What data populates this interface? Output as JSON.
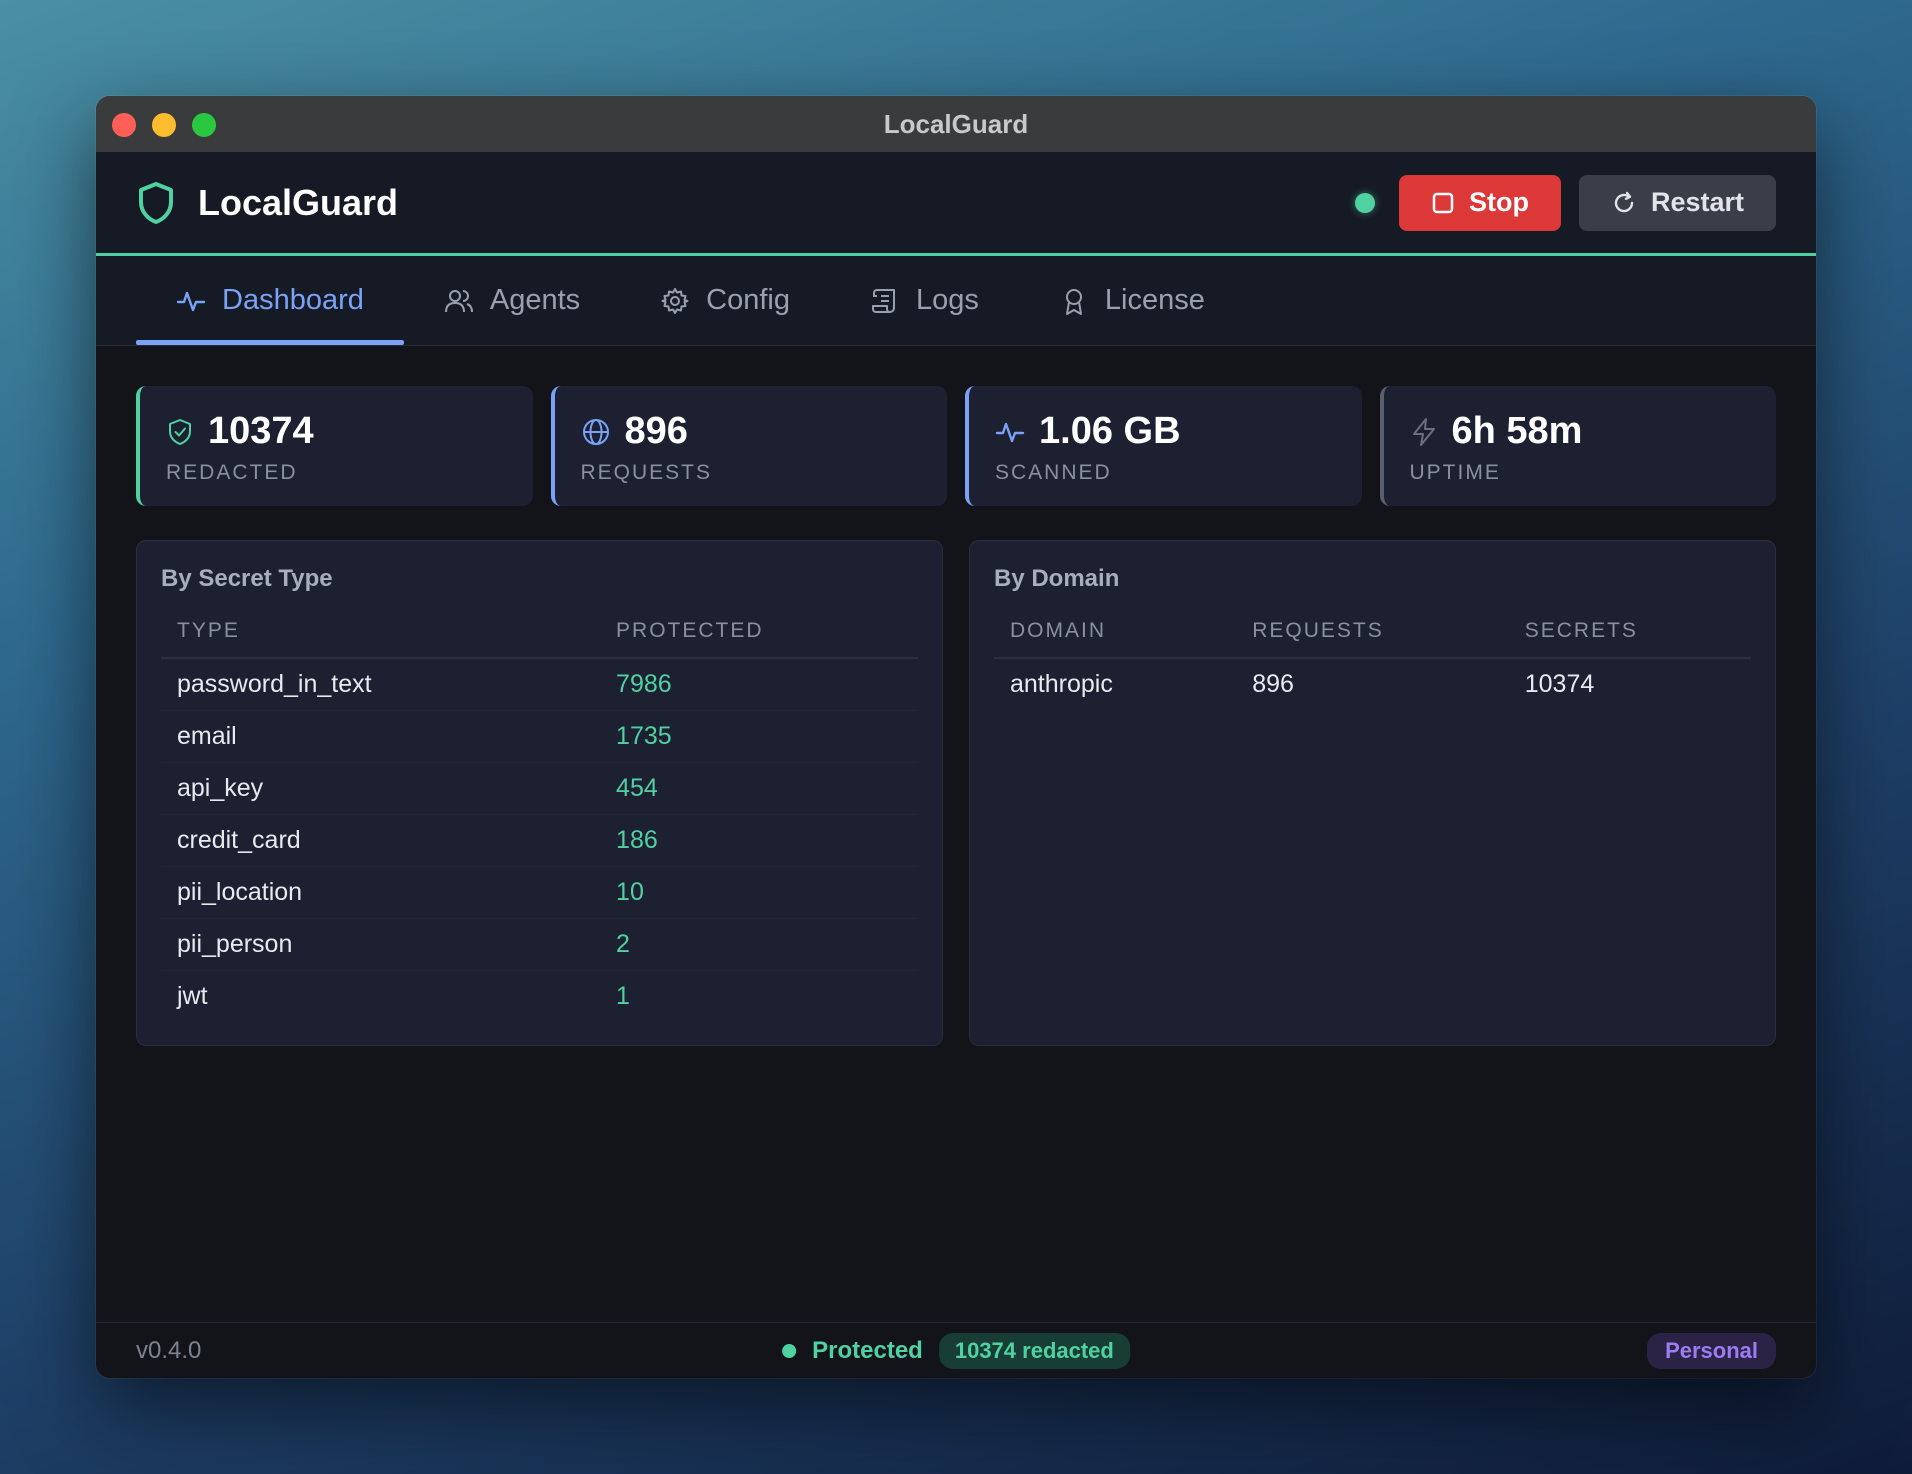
{
  "window": {
    "title": "LocalGuard"
  },
  "header": {
    "brand": "LocalGuard",
    "stop_label": "Stop",
    "restart_label": "Restart"
  },
  "tabs": [
    {
      "label": "Dashboard",
      "icon": "activity-icon"
    },
    {
      "label": "Agents",
      "icon": "users-icon"
    },
    {
      "label": "Config",
      "icon": "gear-icon"
    },
    {
      "label": "Logs",
      "icon": "scroll-icon"
    },
    {
      "label": "License",
      "icon": "award-icon"
    }
  ],
  "stats": [
    {
      "value": "10374",
      "label": "REDACTED",
      "icon": "shield-check-icon"
    },
    {
      "value": "896",
      "label": "REQUESTS",
      "icon": "globe-icon"
    },
    {
      "value": "1.06 GB",
      "label": "SCANNED",
      "icon": "activity-icon"
    },
    {
      "value": "6h 58m",
      "label": "UPTIME",
      "icon": "lightning-icon"
    }
  ],
  "secret_types": {
    "title": "By Secret Type",
    "columns": [
      "TYPE",
      "PROTECTED"
    ],
    "rows": [
      {
        "type": "password_in_text",
        "protected": "7986"
      },
      {
        "type": "email",
        "protected": "1735"
      },
      {
        "type": "api_key",
        "protected": "454"
      },
      {
        "type": "credit_card",
        "protected": "186"
      },
      {
        "type": "pii_location",
        "protected": "10"
      },
      {
        "type": "pii_person",
        "protected": "2"
      },
      {
        "type": "jwt",
        "protected": "1"
      }
    ]
  },
  "domains": {
    "title": "By Domain",
    "columns": [
      "DOMAIN",
      "REQUESTS",
      "SECRETS"
    ],
    "rows": [
      {
        "domain": "anthropic",
        "requests": "896",
        "secrets": "10374"
      }
    ]
  },
  "footer": {
    "version": "v0.4.0",
    "status": "Protected",
    "redacted_badge": "10374 redacted",
    "plan": "Personal"
  },
  "colors": {
    "accent_green": "#4fd1a1",
    "accent_blue": "#7aa2f7",
    "stop_red": "#dc3838",
    "plan_purple": "#9d7cf2"
  }
}
